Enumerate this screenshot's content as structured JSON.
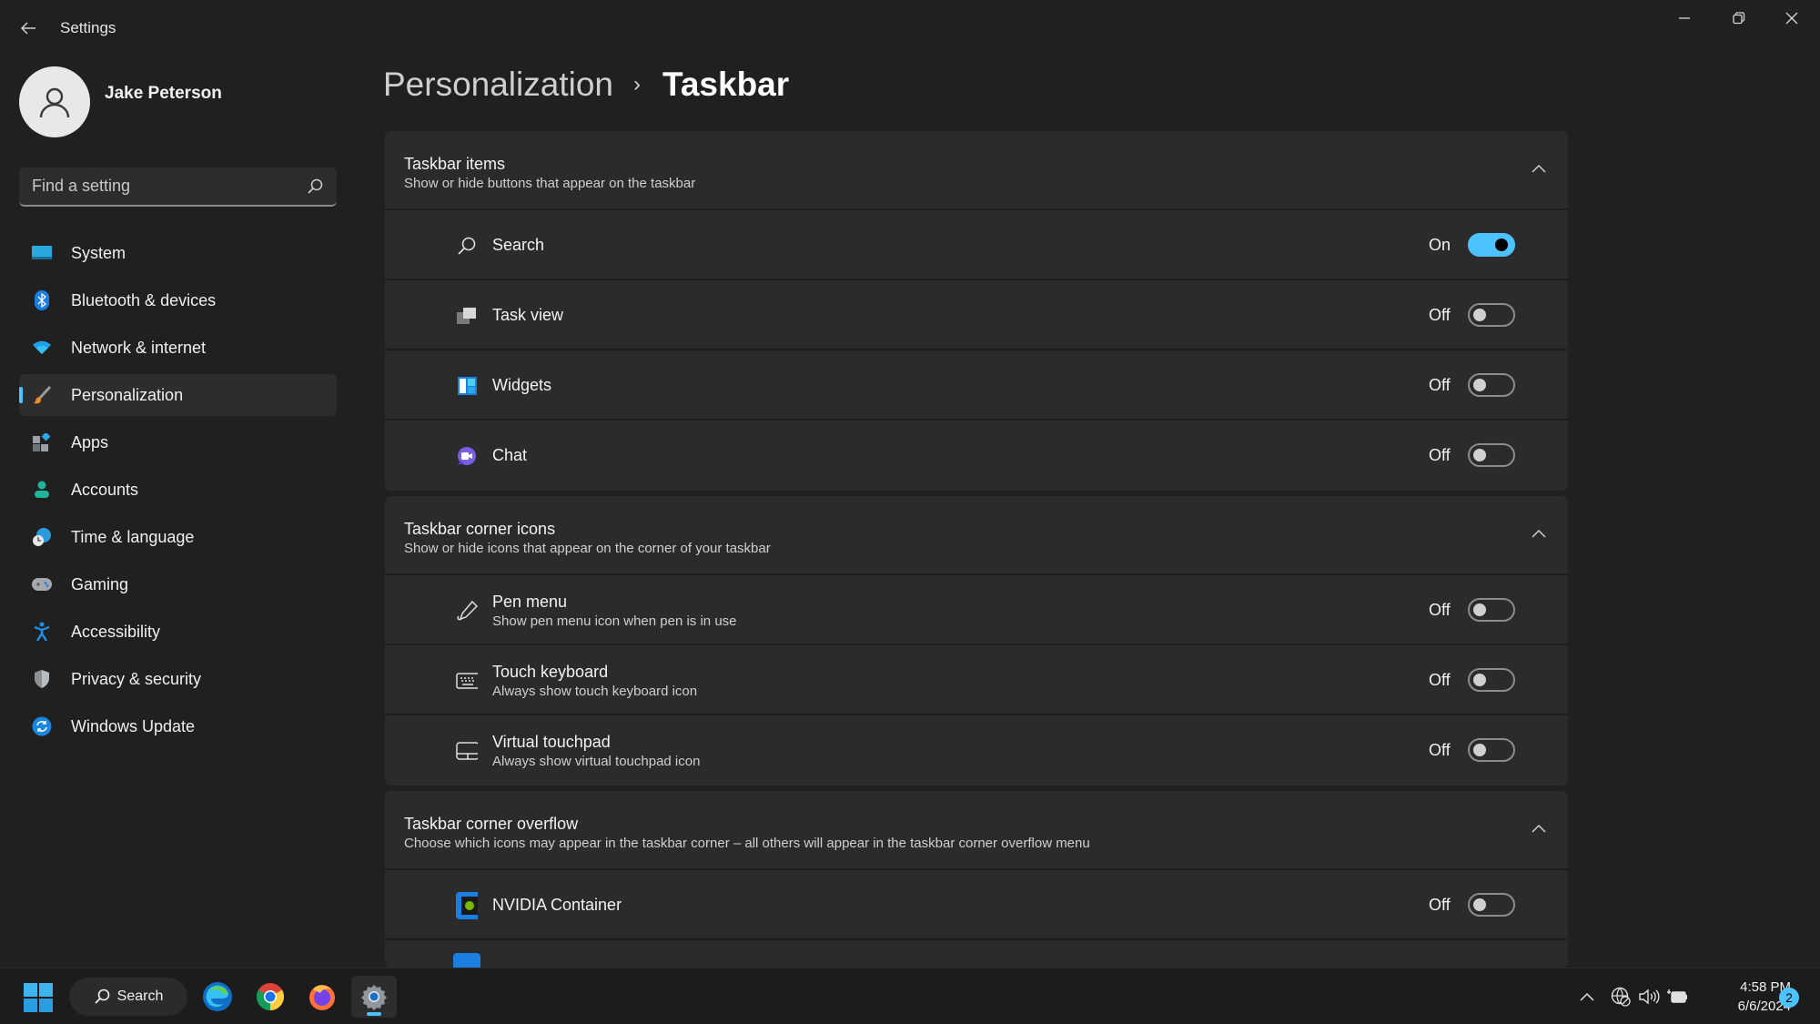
{
  "window": {
    "title": "Settings",
    "controls": {
      "minimize": "minimize",
      "maximize": "restore",
      "close": "close"
    }
  },
  "user": {
    "name": "Jake Peterson"
  },
  "search": {
    "placeholder": "Find a setting",
    "value": ""
  },
  "sidebar": {
    "items": [
      {
        "label": "System",
        "icon": "system-icon",
        "active": false
      },
      {
        "label": "Bluetooth & devices",
        "icon": "bluetooth-icon",
        "active": false
      },
      {
        "label": "Network & internet",
        "icon": "wifi-icon",
        "active": false
      },
      {
        "label": "Personalization",
        "icon": "brush-icon",
        "active": true
      },
      {
        "label": "Apps",
        "icon": "apps-icon",
        "active": false
      },
      {
        "label": "Accounts",
        "icon": "account-icon",
        "active": false
      },
      {
        "label": "Time & language",
        "icon": "time-language-icon",
        "active": false
      },
      {
        "label": "Gaming",
        "icon": "gamepad-icon",
        "active": false
      },
      {
        "label": "Accessibility",
        "icon": "accessibility-icon",
        "active": false
      },
      {
        "label": "Privacy & security",
        "icon": "shield-icon",
        "active": false
      },
      {
        "label": "Windows Update",
        "icon": "update-icon",
        "active": false
      }
    ]
  },
  "breadcrumb": {
    "parent": "Personalization",
    "separator": "›",
    "current": "Taskbar"
  },
  "sections": [
    {
      "title": "Taskbar items",
      "description": "Show or hide buttons that appear on the taskbar",
      "expanded": true,
      "rows": [
        {
          "label": "Search",
          "icon": "search-icon",
          "state": "On",
          "on": true
        },
        {
          "label": "Task view",
          "icon": "task-view-icon",
          "state": "Off",
          "on": false
        },
        {
          "label": "Widgets",
          "icon": "widgets-icon",
          "state": "Off",
          "on": false
        },
        {
          "label": "Chat",
          "icon": "chat-icon",
          "state": "Off",
          "on": false
        }
      ]
    },
    {
      "title": "Taskbar corner icons",
      "description": "Show or hide icons that appear on the corner of your taskbar",
      "expanded": true,
      "rows": [
        {
          "label": "Pen menu",
          "sub": "Show pen menu icon when pen is in use",
          "icon": "pen-icon",
          "state": "Off",
          "on": false
        },
        {
          "label": "Touch keyboard",
          "sub": "Always show touch keyboard icon",
          "icon": "keyboard-icon",
          "state": "Off",
          "on": false
        },
        {
          "label": "Virtual touchpad",
          "sub": "Always show virtual touchpad icon",
          "icon": "touchpad-icon",
          "state": "Off",
          "on": false
        }
      ]
    },
    {
      "title": "Taskbar corner overflow",
      "description": "Choose which icons may appear in the taskbar corner – all others will appear in the taskbar corner overflow menu",
      "expanded": true,
      "rows": [
        {
          "label": "NVIDIA Container",
          "icon": "nvidia-icon",
          "state": "Off",
          "on": false
        }
      ]
    }
  ],
  "taskbar": {
    "search_label": "Search",
    "apps": [
      "edge-icon",
      "chrome-icon",
      "firefox-icon",
      "settings-icon"
    ],
    "active_app": "settings-icon",
    "tray": [
      "show-hidden-icons-chevron",
      "network-icon",
      "volume-icon",
      "battery-icon"
    ],
    "time": "4:58 PM",
    "date": "6/6/2024",
    "notification_count": "2"
  },
  "colors": {
    "accent": "#4cc2ff",
    "background": "#202020",
    "card": "#2b2b2b"
  }
}
